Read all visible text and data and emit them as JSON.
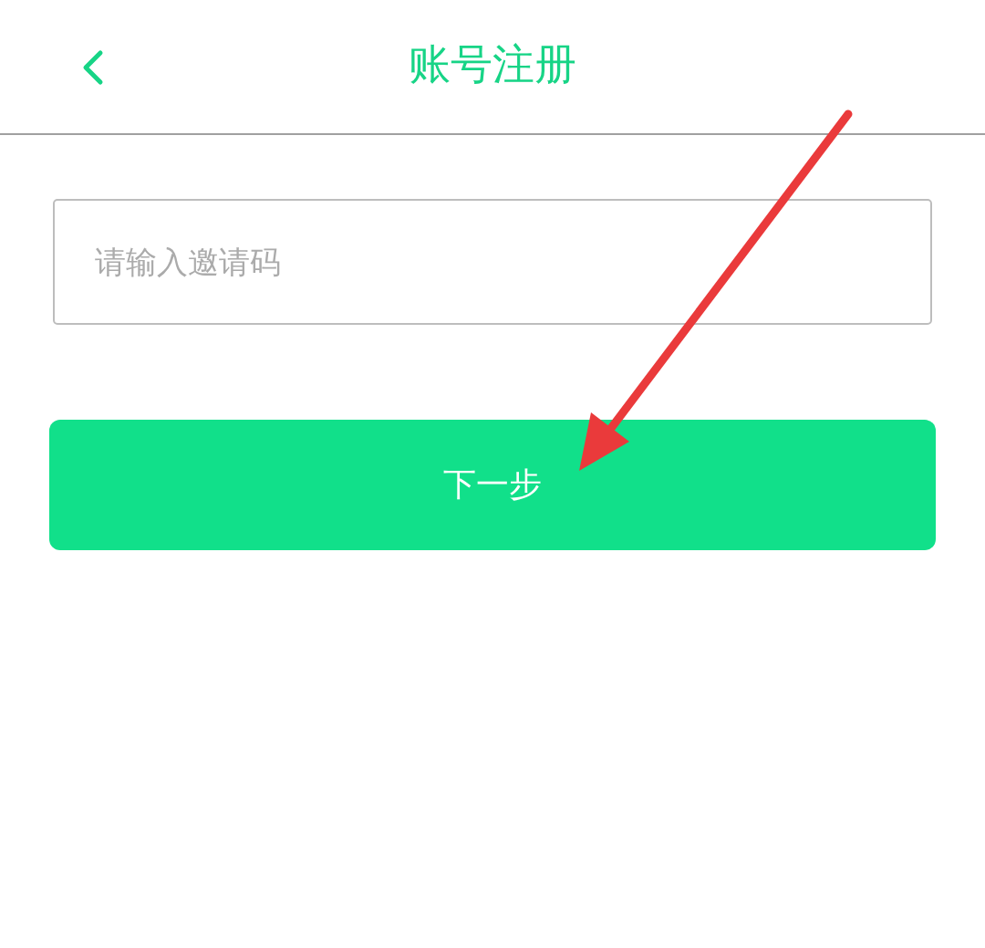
{
  "header": {
    "title": "账号注册"
  },
  "invite_field": {
    "placeholder": "请输入邀请码"
  },
  "next_button": {
    "label": "下一步"
  }
}
